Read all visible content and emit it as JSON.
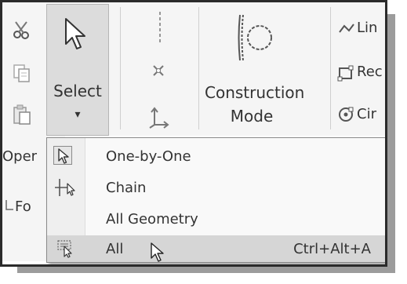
{
  "ribbon": {
    "select_button": {
      "label": "Select",
      "caret": "▾"
    },
    "construction_button": {
      "label_line1": "Construction",
      "label_line2": "Mode"
    },
    "right_items": [
      {
        "label": "Lin",
        "icon": "line-icon"
      },
      {
        "label": "Rec",
        "icon": "rectangle-icon"
      },
      {
        "label": "Cir",
        "icon": "circle-icon"
      }
    ],
    "left_icons": [
      "cut-icon",
      "copy-icon",
      "paste-icon"
    ],
    "group_label_partial": "Oper",
    "side_item_partial": "Fo"
  },
  "select_menu": {
    "items": [
      {
        "label": "One-by-One",
        "icon": "select-cursor-icon",
        "shortcut": ""
      },
      {
        "label": "Chain",
        "icon": "chain-select-icon",
        "shortcut": ""
      },
      {
        "label": "All Geometry",
        "icon": "",
        "shortcut": ""
      },
      {
        "label": "All",
        "icon": "select-all-icon",
        "shortcut": "Ctrl+Alt+A",
        "highlighted": true
      }
    ]
  },
  "colors": {
    "ribbon_bg": "#f5f5f5",
    "menu_bg": "#f9f9f9",
    "highlight": "#d6d6d6",
    "text": "#333333"
  }
}
